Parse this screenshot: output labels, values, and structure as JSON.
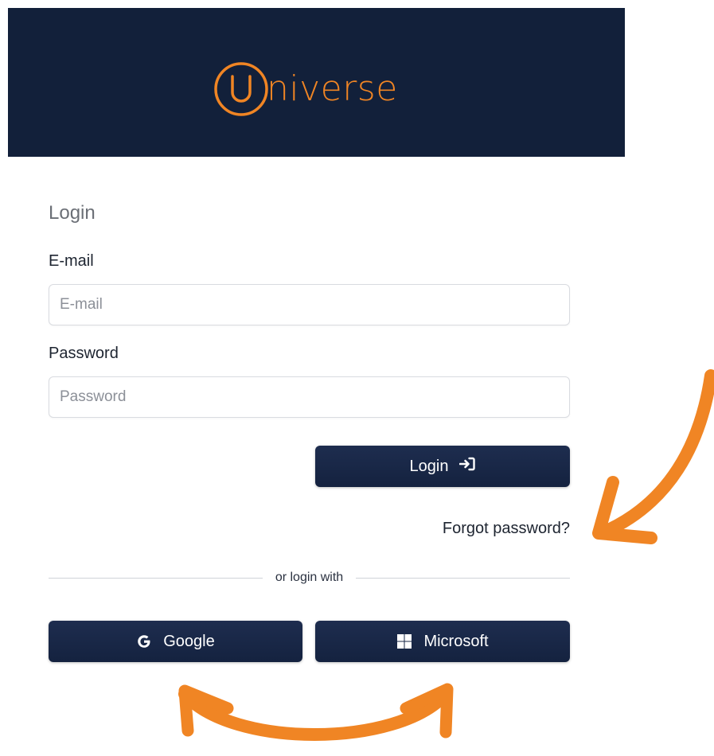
{
  "brand": {
    "logo_letter": "U",
    "logo_rest": "niverse",
    "header_color": "#12203a",
    "accent_color": "#f08524"
  },
  "form": {
    "title": "Login",
    "email_label": "E-mail",
    "email_placeholder": "E-mail",
    "email_value": "",
    "password_label": "Password",
    "password_placeholder": "Password",
    "password_value": "",
    "login_button": "Login",
    "login_icon": "sign-in-icon",
    "forgot_link": "Forgot password?"
  },
  "social": {
    "divider_text": "or login with",
    "google_label": "Google",
    "google_icon": "google-icon",
    "microsoft_label": "Microsoft",
    "microsoft_icon": "windows-icon"
  },
  "annotations": {
    "arrow_color": "#f08524",
    "arrows": [
      "curved-arrow-to-forgot-password",
      "double-curved-arrow-between-social-buttons"
    ]
  }
}
